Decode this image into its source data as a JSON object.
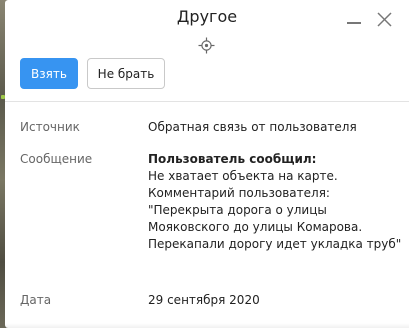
{
  "window": {
    "title": "Другое"
  },
  "actions": {
    "take_label": "Взять",
    "skip_label": "Не брать"
  },
  "fields": {
    "source": {
      "label": "Источник",
      "value": "Обратная связь от пользователя"
    },
    "message": {
      "label": "Сообщение",
      "heading": "Пользователь сообщил:",
      "lines": [
        "Не хватает объекта на карте.",
        "Комментарий пользователя:",
        "\"Перекрыта дорога о улицы",
        "Мояковского до улицы Комарова.",
        "Перекапали дорогу идет укладка труб\""
      ]
    },
    "date": {
      "label": "Дата",
      "value": "29 сентября 2020"
    }
  },
  "icons": {
    "minimize": "minimize-icon",
    "close": "close-icon",
    "locate": "crosshair-icon"
  },
  "colors": {
    "primary": "#3794f1",
    "label_text": "#666666",
    "value_text": "#222222"
  }
}
